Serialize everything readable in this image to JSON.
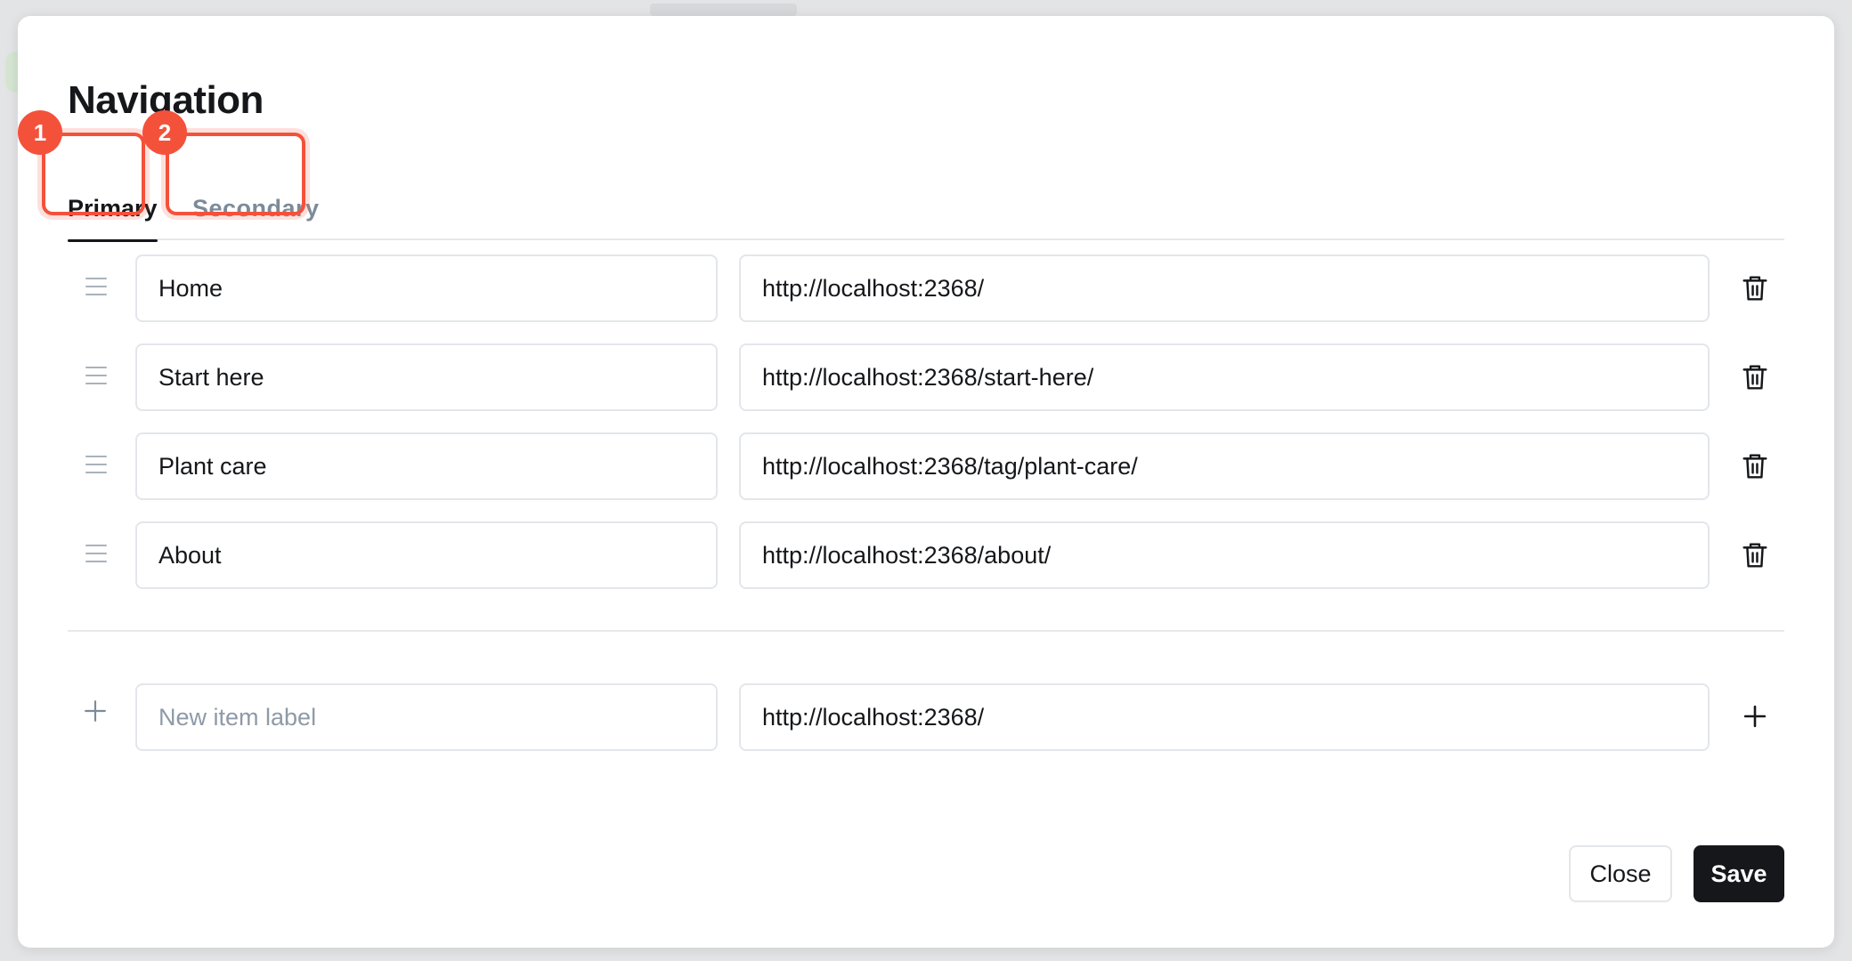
{
  "modal": {
    "title": "Navigation"
  },
  "tabs": [
    {
      "label": "Primary",
      "active": true,
      "badge": "1"
    },
    {
      "label": "Secondary",
      "active": false,
      "badge": "2"
    }
  ],
  "items": [
    {
      "label": "Home",
      "url": "http://localhost:2368/"
    },
    {
      "label": "Start here",
      "url": "http://localhost:2368/start-here/"
    },
    {
      "label": "Plant care",
      "url": "http://localhost:2368/tag/plant-care/"
    },
    {
      "label": "About",
      "url": "http://localhost:2368/about/"
    }
  ],
  "new_item": {
    "label_value": "",
    "label_placeholder": "New item label",
    "url_value": "http://localhost:2368/"
  },
  "footer": {
    "close_label": "Close",
    "save_label": "Save"
  },
  "icons": {
    "drag": "drag-handle-icon",
    "delete": "trash-icon",
    "add": "plus-icon"
  },
  "colors": {
    "highlight": "#f4513b",
    "primary_button": "#15171a",
    "inactive_tab": "#7c8b9a"
  }
}
